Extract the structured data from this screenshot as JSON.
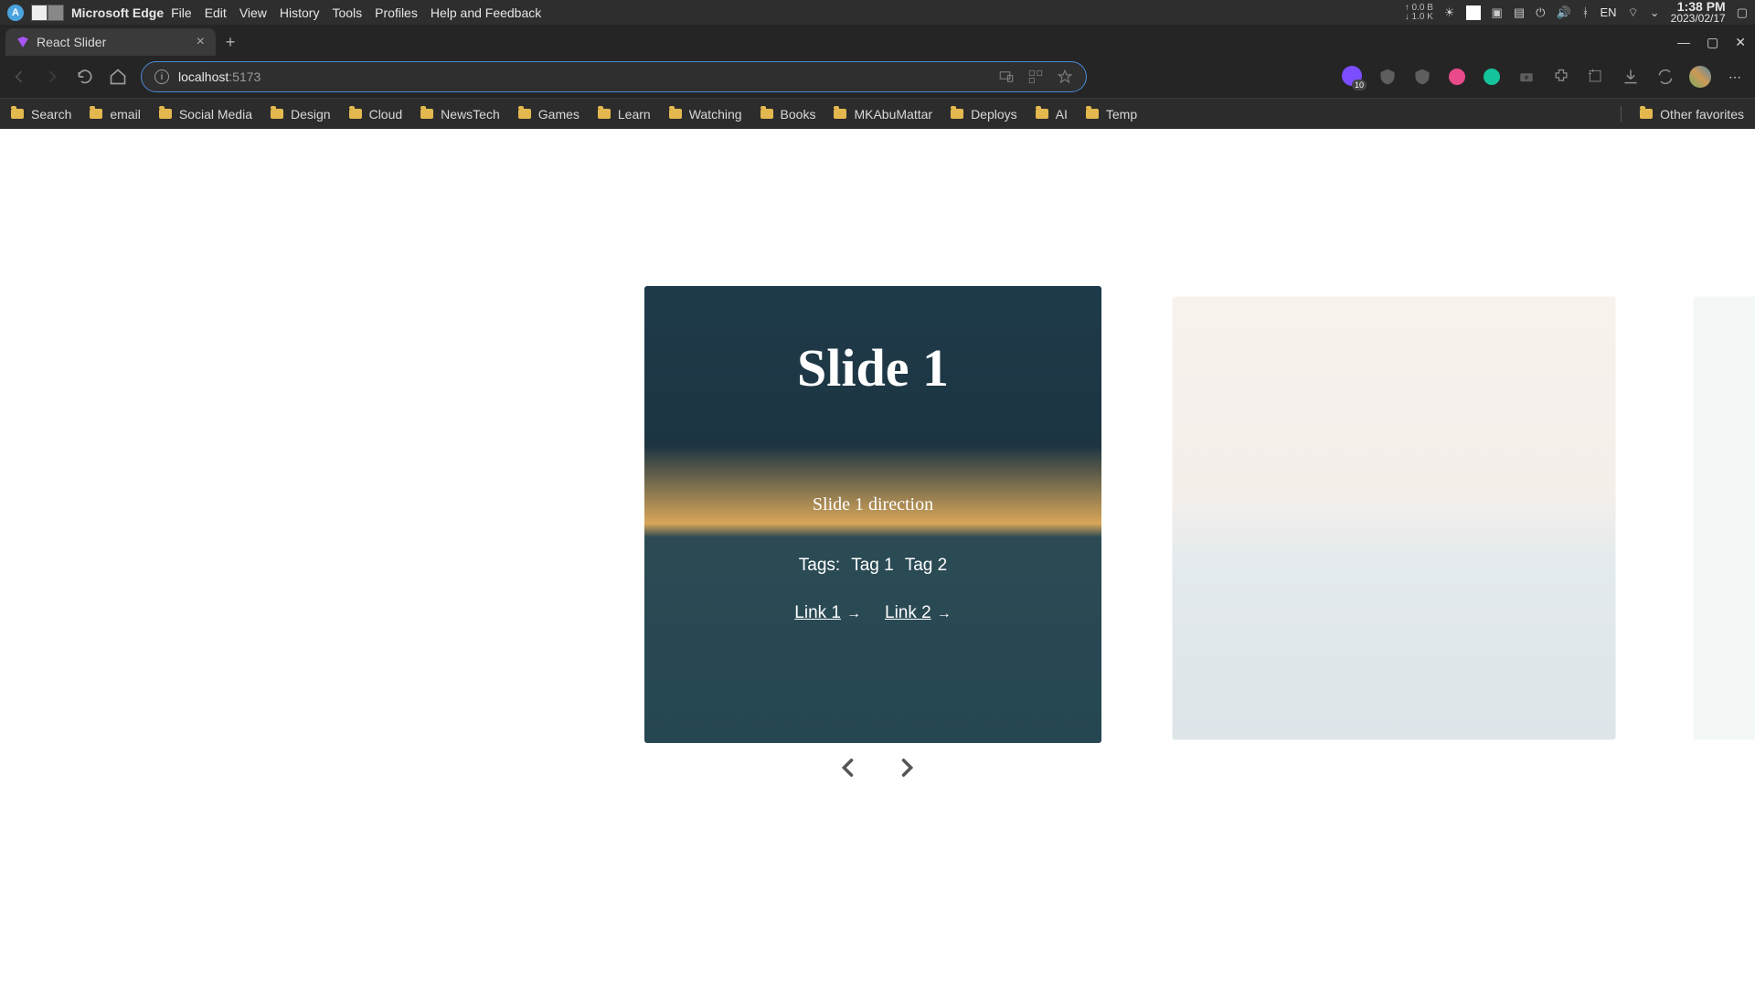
{
  "os": {
    "app_name": "Microsoft Edge",
    "menu": [
      "File",
      "Edit",
      "View",
      "History",
      "Tools",
      "Profiles",
      "Help and Feedback"
    ],
    "net_up": "0.0 B",
    "net_down": "1.0 K",
    "lang": "EN",
    "time": "1:38 PM",
    "date": "2023/02/17"
  },
  "browser": {
    "tab_title": "React Slider",
    "url_host": "localhost",
    "url_port": ":5173",
    "ext_badge": "10",
    "bookmarks": [
      "Search",
      "email",
      "Social Media",
      "Design",
      "Cloud",
      "NewsTech",
      "Games",
      "Learn",
      "Watching",
      "Books",
      "MKAbuMattar",
      "Deploys",
      "AI",
      "Temp"
    ],
    "other": "Other favorites"
  },
  "slider": {
    "active": {
      "title": "Slide 1",
      "direction": "Slide 1 direction",
      "tags_label": "Tags:",
      "tags": [
        "Tag 1",
        "Tag 2"
      ],
      "links": [
        "Link 1",
        "Link 2"
      ]
    }
  }
}
